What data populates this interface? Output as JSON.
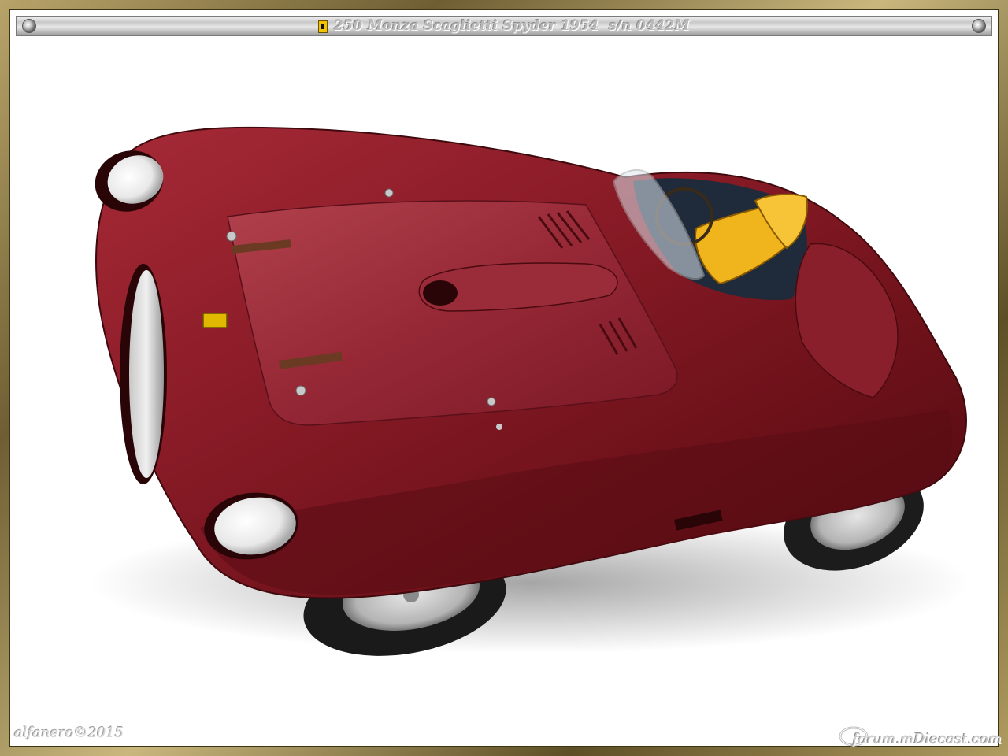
{
  "title_bar": {
    "title": "250 Monza Scaglietti Spyder 1954  s/n 0442M"
  },
  "photo": {
    "subject": "red scale model car",
    "body_color": "#7d1a22",
    "seat_color": "#f0b41c"
  },
  "watermarks": {
    "author": "alfanero©2015",
    "forum": "forum.mDiecast.com"
  },
  "colors": {
    "frame": "#8a7a4a",
    "background": "#ffffff"
  }
}
